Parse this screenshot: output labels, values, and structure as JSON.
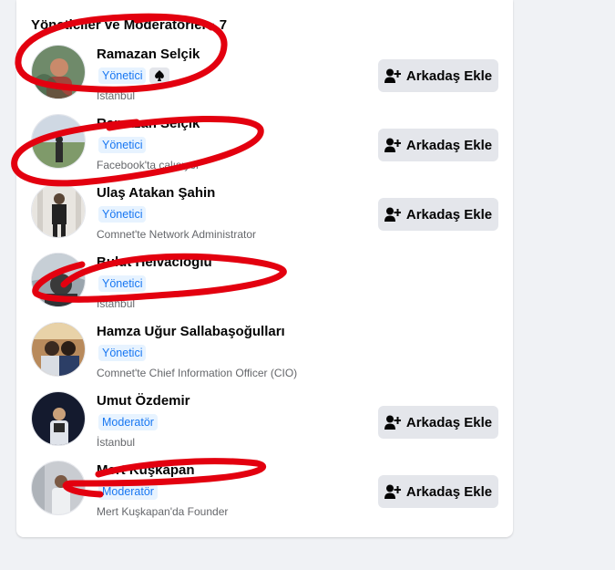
{
  "section": {
    "title": "Yöneticiler ve Moderatörler · 7"
  },
  "button_label": "Arkadaş Ekle",
  "members": [
    {
      "name": "Ramazan Selçik",
      "badge": "Yönetici",
      "subtitle": "İstanbul",
      "has_button": true,
      "extra_icon": "spade-icon"
    },
    {
      "name": "Ramazan Selçik",
      "badge": "Yönetici",
      "subtitle": "Facebook'ta çalışıyor",
      "has_button": true
    },
    {
      "name": "Ulaş Atakan Şahin",
      "badge": "Yönetici",
      "subtitle": "Comnet'te Network Administrator",
      "has_button": true
    },
    {
      "name": "Bulut Helvacioglu",
      "badge": "Yönetici",
      "subtitle": "İstanbul",
      "has_button": false
    },
    {
      "name": "Hamza Uğur Sallabaşoğulları",
      "badge": "Yönetici",
      "subtitle": "Comnet'te Chief Information Officer (CIO)",
      "has_button": false
    },
    {
      "name": "Umut Özdemir",
      "badge": "Moderatör",
      "subtitle": "İstanbul",
      "has_button": true
    },
    {
      "name": "Mert Kuşkapan",
      "badge": "Moderatör",
      "subtitle": "Mert Kuşkapan'da Founder",
      "has_button": true
    }
  ],
  "colors": {
    "annotation": "#e3000f",
    "accent": "#1877f2",
    "badge_bg": "#e7f3ff"
  }
}
